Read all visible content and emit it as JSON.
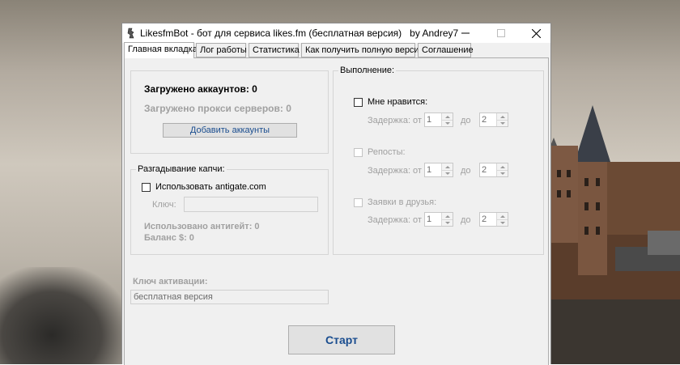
{
  "window": {
    "title": "LikesfmBot - бот для сервиса likes.fm (бесплатная версия)   by Andrey7"
  },
  "tabs": [
    {
      "label": "Главная вкладка"
    },
    {
      "label": "Лог работы"
    },
    {
      "label": "Статистика"
    },
    {
      "label": "Как получить полную версию"
    },
    {
      "label": "Соглашение"
    }
  ],
  "accounts": {
    "loaded_accounts": "Загружено аккаунтов: 0",
    "loaded_proxies": "Загружено прокси серверов: 0",
    "add_button": "Добавить аккаунты"
  },
  "captcha": {
    "title": "Разгадывание капчи:",
    "use_antigate": "Использовать antigate.com",
    "key_label": "Ключ:",
    "key_value": "",
    "used": "Использовано антигейт: 0",
    "balance": "Баланс $: 0"
  },
  "execution": {
    "title": "Выполнение:",
    "actions": [
      {
        "label": "Мне нравится:",
        "delay_label": "Задержка: от",
        "to_label": "до",
        "from": "1",
        "to": "2"
      },
      {
        "label": "Репосты:",
        "delay_label": "Задержка: от",
        "to_label": "до",
        "from": "1",
        "to": "2"
      },
      {
        "label": "Заявки в друзья:",
        "delay_label": "Задержка: от",
        "to_label": "до",
        "from": "1",
        "to": "2"
      }
    ]
  },
  "activation": {
    "label": "Ключ активации:",
    "value": "бесплатная версия"
  },
  "start_button": "Старт"
}
